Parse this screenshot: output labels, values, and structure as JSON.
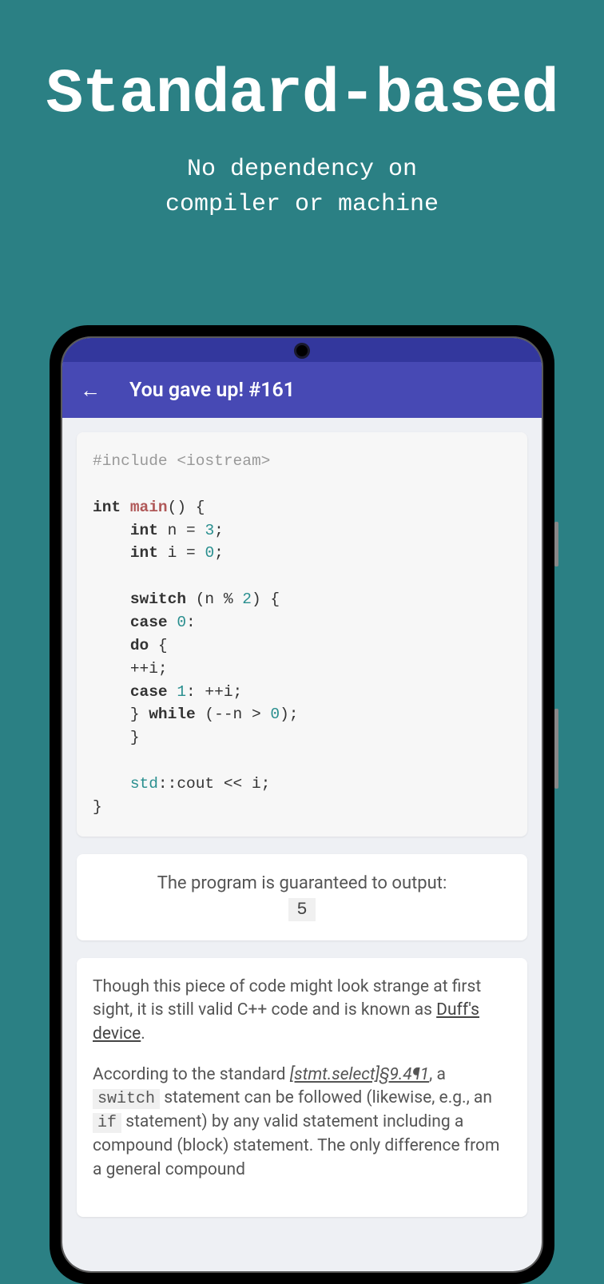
{
  "hero": {
    "title": "Standard-based",
    "subtitle_line1": "No dependency on",
    "subtitle_line2": "compiler or machine"
  },
  "appbar": {
    "title": "You gave up! #161"
  },
  "code": {
    "line_include_pre": "#include ",
    "line_include_lib": "<iostream>",
    "kw_int": "int",
    "fn_main": "main",
    "main_paren": "() {",
    "decl_n_pre": " n = ",
    "num_3": "3",
    "semicolon": ";",
    "decl_i_pre": " i = ",
    "num_0": "0",
    "kw_switch": "switch",
    "switch_expr_open": " (n % ",
    "num_2": "2",
    "switch_expr_close": ") {",
    "kw_case": "case",
    "case0_rest": ":",
    "kw_do": "do",
    "do_brace": " {",
    "inc_i": "++i;",
    "num_1": "1",
    "case1_rest": ": ++i;",
    "close_brace": "} ",
    "kw_while": "while",
    "while_expr": " (--n > ",
    "while_close": ");",
    "brace_close": "}",
    "ns_std": "std",
    "cout_rest": "::cout << i;"
  },
  "output": {
    "label": "The program is guaranteed to output:",
    "value": "5"
  },
  "explanation": {
    "p1_a": "Though this piece of code might look strange at first sight, it is still valid C++ code and is known as ",
    "p1_link": "Duff's device",
    "p1_b": ".",
    "p2_a": "According to the standard ",
    "p2_ref": "[stmt.select]§9.4¶1",
    "p2_b": ", a ",
    "p2_code1": "switch",
    "p2_c": " statement can be followed (likewise, e.g., an ",
    "p2_code2": "if",
    "p2_d": " statement) by any valid statement including a compound (block) statement. The only difference from a general compound"
  }
}
